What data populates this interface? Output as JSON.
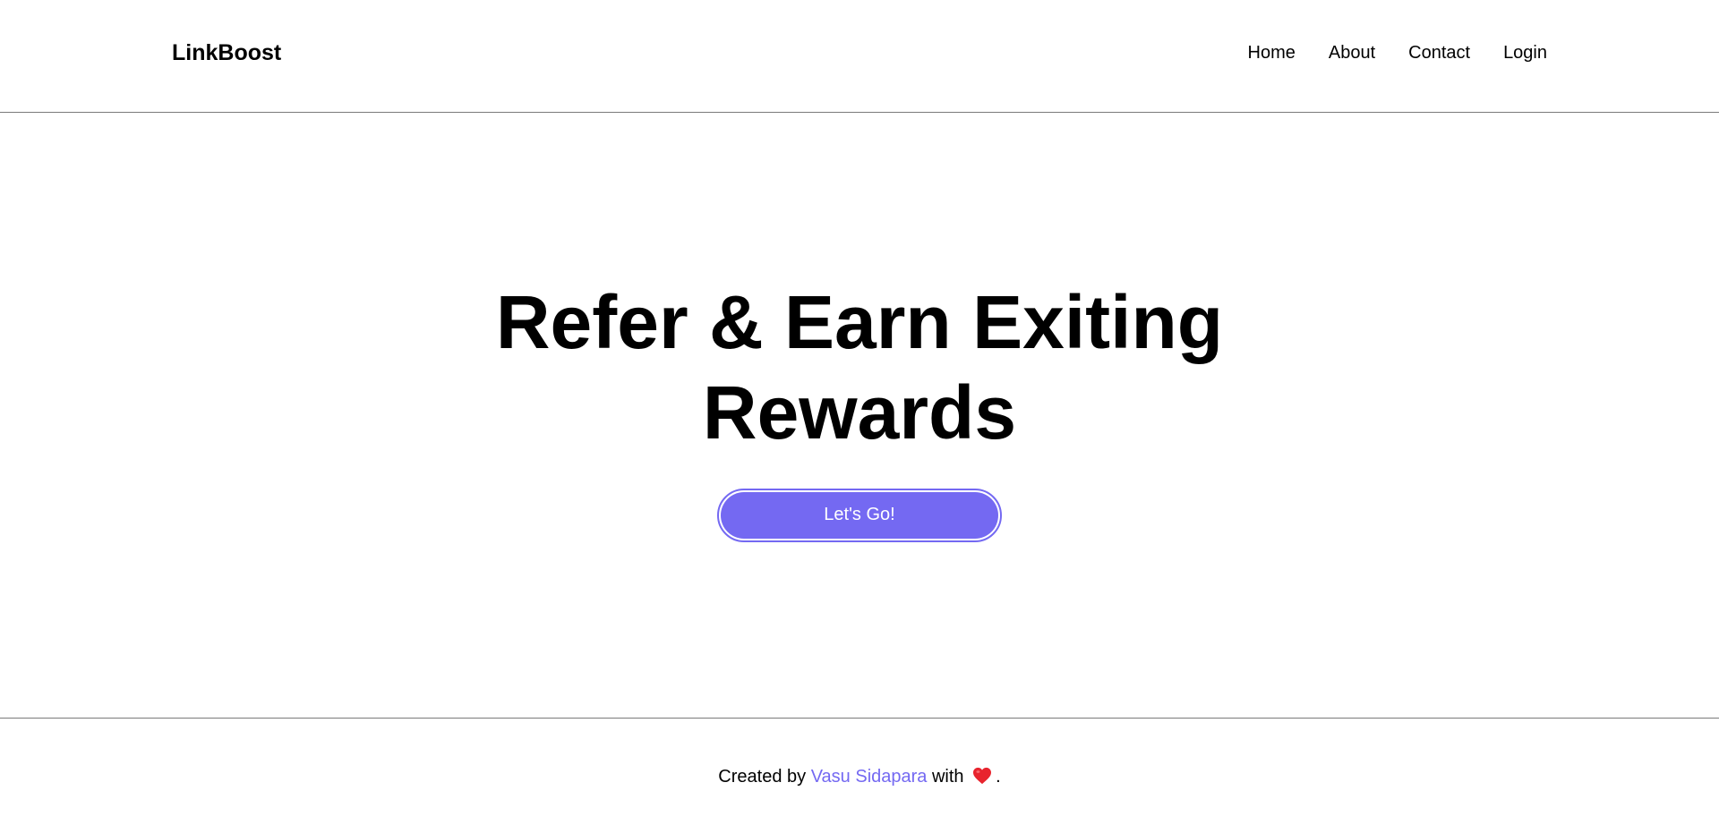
{
  "navbar": {
    "brand": "LinkBoost",
    "links": [
      {
        "label": "Home"
      },
      {
        "label": "About"
      },
      {
        "label": "Contact"
      },
      {
        "label": "Login"
      }
    ]
  },
  "hero": {
    "title": "Refer & Earn Exiting Rewards",
    "cta_label": "Let's Go!"
  },
  "footer": {
    "prefix": "Created by",
    "author": "Vasu Sidapara",
    "middle": "with",
    "heart_icon": "heart-icon",
    "suffix": "."
  },
  "colors": {
    "accent": "#7469f2",
    "heart": "#e8242e",
    "divider": "#7a7a7a"
  }
}
